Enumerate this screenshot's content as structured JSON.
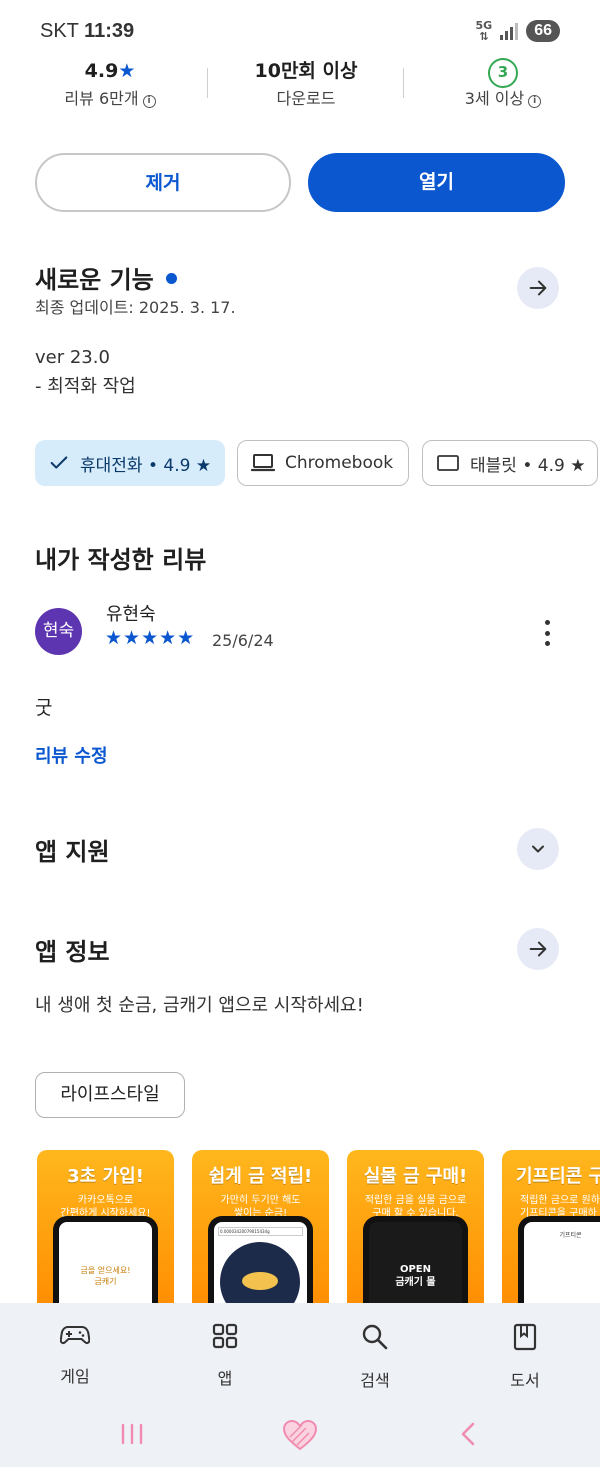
{
  "status_bar": {
    "carrier": "SKT",
    "time": "11:39",
    "network": "5G",
    "battery": "66"
  },
  "stats": {
    "rating": {
      "value": "4.9",
      "star": "★",
      "label": "리뷰 6만개"
    },
    "downloads": {
      "value": "10만회 이상",
      "label": "다운로드"
    },
    "age": {
      "badge": "3",
      "label": "3세 이상"
    }
  },
  "actions": {
    "remove_label": "제거",
    "open_label": "열기"
  },
  "whats_new": {
    "title": "새로운 기능",
    "updated": "최종 업데이트: 2025. 3. 17.",
    "notes": [
      "ver 23.0",
      "- 최적화 작업"
    ]
  },
  "device_chips": [
    {
      "label": "휴대전화 • 4.9 ★",
      "icon": "check-icon",
      "selected": true
    },
    {
      "label": "Chromebook",
      "icon": "laptop-icon",
      "selected": false
    },
    {
      "label": "태블릿 • 4.9 ★",
      "icon": "tablet-icon",
      "selected": false
    }
  ],
  "my_review": {
    "title": "내가 작성한 리뷰",
    "avatar_text": "현숙",
    "reviewer": "유현숙",
    "stars": "★★★★★",
    "rating": 5,
    "date": "25/6/24",
    "text": "굿",
    "edit_label": "리뷰 수정"
  },
  "app_support": {
    "title": "앱 지원"
  },
  "app_info": {
    "title": "앱 정보",
    "description": "내 생애 첫 순금, 금캐기 앱으로 시작하세요!",
    "category": "라이프스타일"
  },
  "screenshots": [
    {
      "title": "3초 가입!",
      "subtitle": "카카오톡으로\n간편하게 시작하세요!",
      "screen_text": "금을 얻으세요!\n금캐기"
    },
    {
      "title": "쉽게 금 적립!",
      "subtitle": "가만히 두기만 해도\n쌓이는 순금!",
      "screen_text": "0.00003420079015434g"
    },
    {
      "title": "실물 금 구매!",
      "subtitle": "적립한 금을 실물 금으로\n구매 할 수 있습니다.",
      "screen_text": "OPEN\n금캐기 몰"
    },
    {
      "title": "기프티콘 구",
      "subtitle": "적립한 금으로 원하\n기프티콘을 구매하",
      "screen_text": "기프티콘"
    }
  ],
  "bottom_nav": [
    {
      "label": "게임",
      "icon": "gamepad-icon"
    },
    {
      "label": "앱",
      "icon": "apps-grid-icon"
    },
    {
      "label": "검색",
      "icon": "search-icon"
    },
    {
      "label": "도서",
      "icon": "book-icon"
    }
  ],
  "colors": {
    "accent": "#0b57d0",
    "chip_selected_bg": "#d6ecfb",
    "age_green": "#34a853",
    "avatar": "#5e35b1",
    "nav_pink": "#f08cb0"
  }
}
